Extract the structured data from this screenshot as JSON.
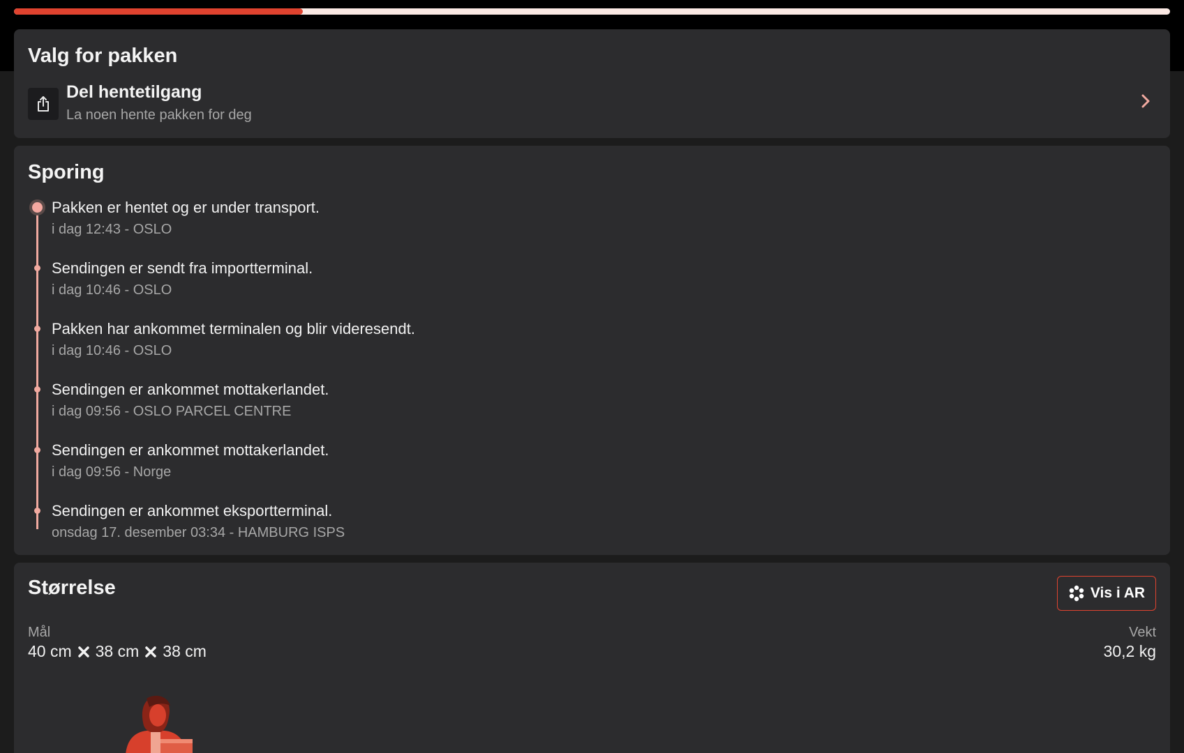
{
  "progress": {
    "fraction": 0.25,
    "fill_color": "#e0432f",
    "track_color": "#fbe9e4"
  },
  "options_card": {
    "title": "Valg for pakken",
    "share": {
      "icon": "share-icon",
      "title": "Del hentetilgang",
      "subtitle": "La noen hente pakken for deg"
    }
  },
  "tracking": {
    "title": "Sporing",
    "events": [
      {
        "text": "Pakken er hentet og er under transport.",
        "meta": "i dag 12:43 - OSLO",
        "current": true
      },
      {
        "text": "Sendingen er sendt fra importterminal.",
        "meta": "i dag 10:46 - OSLO"
      },
      {
        "text": "Pakken har ankommet terminalen og blir videresendt.",
        "meta": "i dag 10:46 - OSLO"
      },
      {
        "text": "Sendingen er ankommet mottakerlandet.",
        "meta": "i dag 09:56 - OSLO PARCEL CENTRE"
      },
      {
        "text": "Sendingen er ankommet mottakerlandet.",
        "meta": "i dag 09:56 - Norge"
      },
      {
        "text": "Sendingen er ankommet eksportterminal.",
        "meta": "onsdag 17. desember 03:34 - HAMBURG ISPS"
      }
    ]
  },
  "size_card": {
    "title": "Størrelse",
    "ar_button": "Vis i AR",
    "dimensions_label": "Mål",
    "dimensions": [
      "40 cm",
      "38 cm",
      "38 cm"
    ],
    "weight_label": "Vekt",
    "weight_value": "30,2 kg"
  },
  "colors": {
    "accent": "#e0432f",
    "card_bg": "#2c2c2e",
    "timeline": "#f1aaa0"
  }
}
